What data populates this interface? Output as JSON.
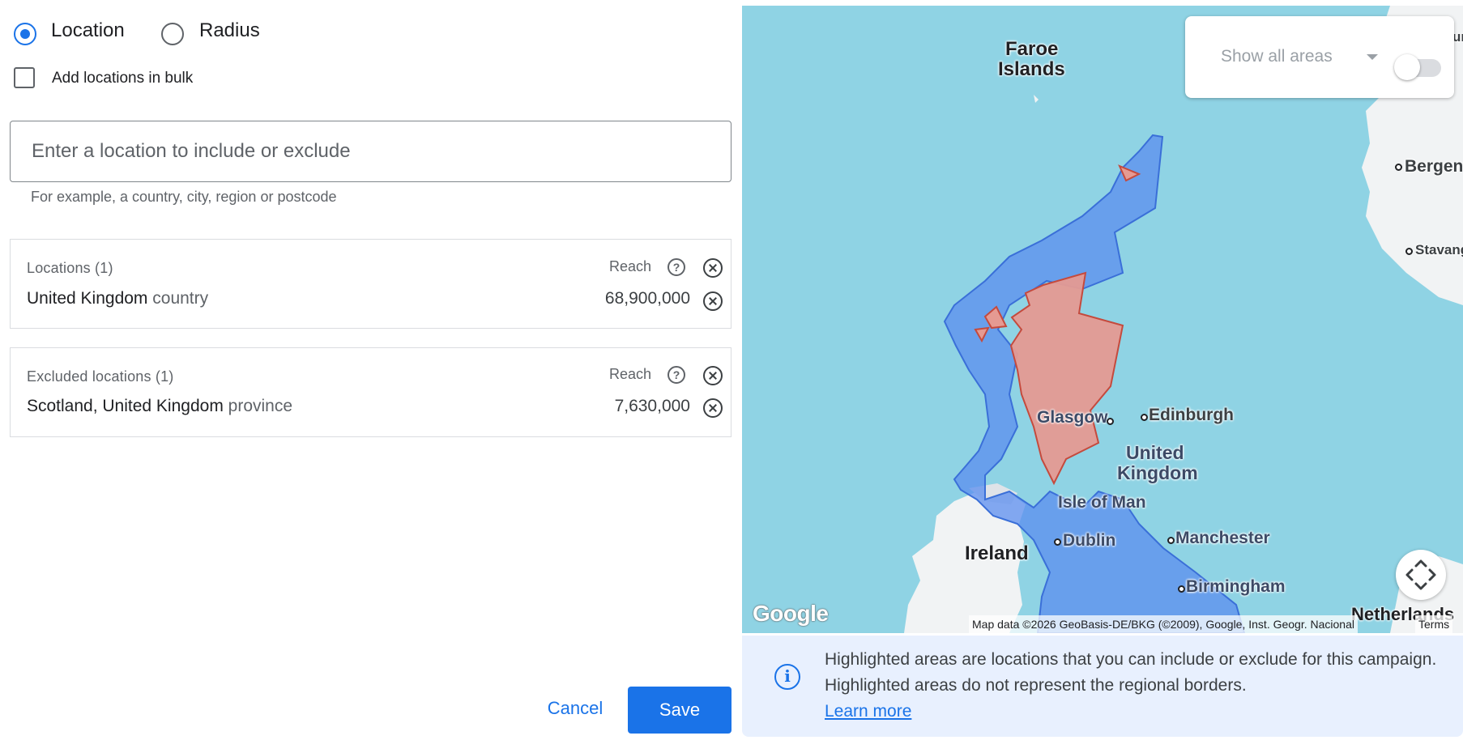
{
  "target_type": {
    "location_label": "Location",
    "radius_label": "Radius",
    "selected": "Location"
  },
  "bulk": {
    "label": "Add locations in bulk",
    "checked": false
  },
  "search": {
    "placeholder": "Enter a location to include or exclude",
    "value": "",
    "helper": "For example, a country, city, region or postcode"
  },
  "locations": {
    "title": "Locations (1)",
    "reach_label": "Reach",
    "help_icon": "help-circle-icon",
    "items": [
      {
        "name": "United Kingdom",
        "type": "country",
        "reach": "68,900,000"
      }
    ]
  },
  "excluded": {
    "title": "Excluded locations (1)",
    "reach_label": "Reach",
    "items": [
      {
        "name": "Scotland, United Kingdom",
        "type": "province",
        "reach": "7,630,000"
      }
    ]
  },
  "actions": {
    "cancel": "Cancel",
    "save": "Save"
  },
  "map": {
    "show_all_areas": "Show all areas",
    "show_all_areas_on": false,
    "labels": {
      "faroe_1": "Faroe",
      "faroe_2": "Islands",
      "bergen": "Bergen",
      "stavanger": "Stavang",
      "glasgow": "Glasgow",
      "edinburgh": "Edinburgh",
      "uk_1": "United",
      "uk_2": "Kingdom",
      "isle_of_man": "Isle of Man",
      "dublin": "Dublin",
      "ireland": "Ireland",
      "manchester": "Manchester",
      "birmingham": "Birmingham",
      "netherlands": "Netherlands",
      "edge_fragment": "ur"
    },
    "google_logo": "Google",
    "attribution": "Map data ©2026 GeoBasis-DE/BKG (©2009), Google, Inst. Geogr. Nacional",
    "terms": "Terms",
    "colors": {
      "water": "#8fd3e4",
      "land": "#f1f3f4",
      "included": "#5b8def",
      "excluded": "#e59a92"
    }
  },
  "info": {
    "icon": "info-icon",
    "text": "Highlighted areas are locations that you can include or exclude for this campaign. Highlighted areas do not represent the regional borders.",
    "link": "Learn more"
  }
}
